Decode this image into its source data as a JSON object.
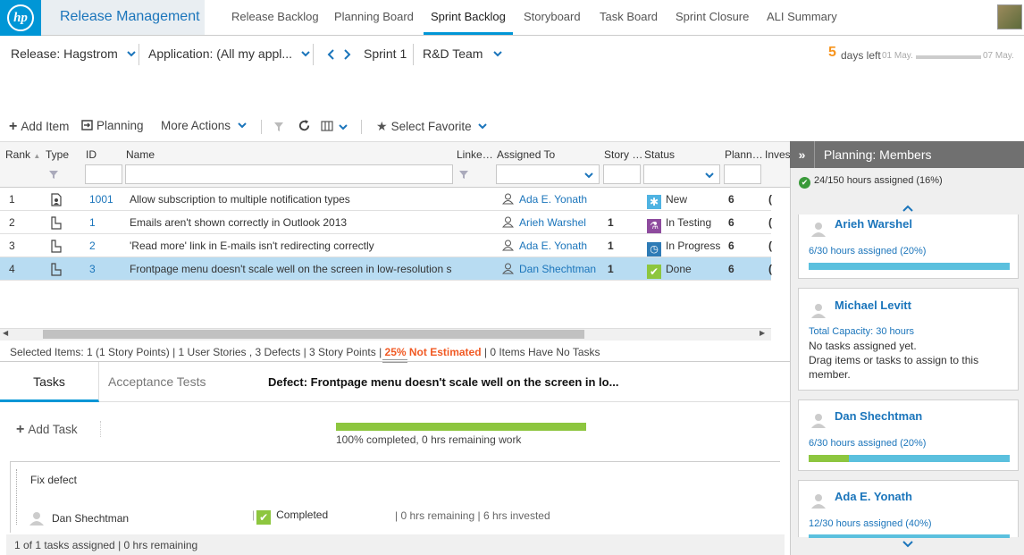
{
  "app": {
    "logo_text": "hp",
    "name": "Release Management",
    "tabs": [
      "Release Backlog",
      "Planning Board",
      "Sprint Backlog",
      "Storyboard",
      "Task Board",
      "Sprint Closure",
      "ALI Summary"
    ],
    "active_tab": "Sprint Backlog"
  },
  "filters": {
    "release": "Release: Hagstrom",
    "application": "Application: (All my appl...",
    "sprint": "Sprint 1",
    "team": "R&D Team",
    "days_left_num": "5",
    "days_left_label": "days left",
    "start_date": "01 May.",
    "end_date": "07 May."
  },
  "toolbar": {
    "add_item": "Add Item",
    "planning": "Planning",
    "more_actions": "More Actions",
    "select_favorite": "Select Favorite"
  },
  "grid": {
    "headers": {
      "rank": "Rank",
      "type": "Type",
      "id": "ID",
      "name": "Name",
      "linked": "Linke…",
      "assigned": "Assigned To",
      "story": "Story …",
      "status": "Status",
      "planned": "Plann…",
      "invested": "Invest"
    },
    "rows": [
      {
        "rank": "1",
        "id": "1001",
        "name": "Allow subscription to multiple notification types",
        "assigned": "Ada E. Yonath",
        "story": "",
        "status": "New",
        "planned": "6",
        "invested": "("
      },
      {
        "rank": "2",
        "id": "1",
        "name": "Emails aren't shown correctly in Outlook 2013",
        "assigned": "Arieh Warshel",
        "story": "1",
        "status": "In Testing",
        "planned": "6",
        "invested": "("
      },
      {
        "rank": "3",
        "id": "2",
        "name": "'Read more' link in E-mails isn't redirecting correctly",
        "assigned": "Ada E. Yonath",
        "story": "1",
        "status": "In Progress",
        "planned": "6",
        "invested": "("
      },
      {
        "rank": "4",
        "id": "3",
        "name": "Frontpage menu doesn't scale well on the screen in low-resolution scre...",
        "assigned": "Dan Shechtman",
        "story": "1",
        "status": "Done",
        "planned": "6",
        "invested": "("
      }
    ],
    "summary_a": "Selected Items: 1 (1 Story Points) | 1 User Stories , 3 Defects | 3 Story Points | ",
    "summary_b": "25% Not Estimated",
    "summary_c": " | 0 Items Have No Tasks"
  },
  "details": {
    "tab_tasks": "Tasks",
    "tab_acceptance": "Acceptance Tests",
    "title": "Defect: Frontpage menu doesn't scale well on the screen in lo...",
    "add_task": "Add Task",
    "progress_pct": 100,
    "progress_text": "100% completed, 0 hrs remaining work",
    "task_name": "Fix defect",
    "task_owner": "Dan Shechtman",
    "task_status": "Completed",
    "task_info": "| 0 hrs remaining | 6 hrs invested",
    "footer": "1 of 1 tasks assigned | 0 hrs remaining"
  },
  "panel": {
    "title": "Planning: Members",
    "total": "24/150 hours assigned (16%)",
    "members": [
      {
        "name": "Arieh Warshel",
        "hours": "6/30 hours assigned (20%)",
        "fill": 0
      },
      {
        "name": "Michael Levitt",
        "capacity": "Total Capacity: 30 hours",
        "note1": "No tasks assigned yet.",
        "note2": "Drag items or tasks to assign to this member."
      },
      {
        "name": "Dan Shechtman",
        "hours": "6/30 hours assigned (20%)",
        "fill": 20
      },
      {
        "name": "Ada E. Yonath",
        "hours": "12/30 hours assigned (40%)",
        "fill": 0
      }
    ]
  },
  "colors": {
    "accent": "#0096d6",
    "link": "#1b75bb",
    "progress": "#8dc63f",
    "warning": "#f15a24",
    "days": "#f7941d"
  }
}
